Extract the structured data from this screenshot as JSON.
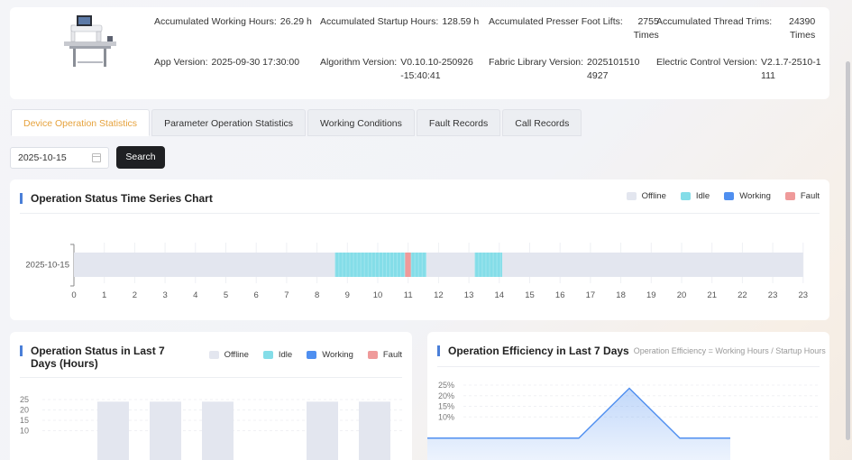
{
  "device_info": {
    "row1": [
      {
        "label": "Accumulated Working Hours:",
        "value": "26.29 h"
      },
      {
        "label": "Accumulated Startup Hours:",
        "value": "128.59 h"
      },
      {
        "label": "Accumulated Presser Foot Lifts:",
        "value": "2755 Times"
      },
      {
        "label": "Accumulated Thread Trims:",
        "value": "24390 Times"
      }
    ],
    "row2": [
      {
        "label": "App Version:",
        "value": "2025-09-30 17:30:00"
      },
      {
        "label": "Algorithm Version:",
        "value": "V0.10.10-250926-15:40:41"
      },
      {
        "label": "Fabric Library Version:",
        "value": "20251015104927"
      },
      {
        "label": "Electric Control Version:",
        "value": "V2.1.7-2510-1111"
      }
    ]
  },
  "tabs": [
    {
      "label": "Device Operation Statistics",
      "active": true
    },
    {
      "label": "Parameter Operation Statistics",
      "active": false
    },
    {
      "label": "Working Conditions",
      "active": false
    },
    {
      "label": "Fault Records",
      "active": false
    },
    {
      "label": "Call Records",
      "active": false
    }
  ],
  "search": {
    "date": "2025-10-15",
    "button_label": "Search"
  },
  "colors": {
    "offline": "#e3e6ef",
    "idle": "#84dde8",
    "working": "#4f8ff0",
    "fault": "#ef9a9a",
    "accent_tab": "#e6a23c",
    "title_bar": "#4a7fd8"
  },
  "legend_labels": {
    "offline": "Offline",
    "idle": "Idle",
    "working": "Working",
    "fault": "Fault"
  },
  "timeseries": {
    "title": "Operation Status Time Series Chart",
    "chart_data": {
      "type": "timeline",
      "row_label": "2025-10-15",
      "x_ticks": [
        "0",
        "1",
        "2",
        "3",
        "4",
        "5",
        "6",
        "7",
        "8",
        "9",
        "10",
        "11",
        "12",
        "13",
        "14",
        "15",
        "16",
        "17",
        "18",
        "19",
        "20",
        "21",
        "22",
        "23",
        "23"
      ],
      "xlim": [
        0,
        24
      ],
      "segments": [
        {
          "status": "offline",
          "start": 0,
          "end": 8.6
        },
        {
          "status": "idle",
          "start": 8.6,
          "end": 10.9
        },
        {
          "status": "fault",
          "start": 10.9,
          "end": 11.1
        },
        {
          "status": "idle",
          "start": 11.1,
          "end": 11.6
        },
        {
          "status": "offline",
          "start": 11.6,
          "end": 13.2
        },
        {
          "status": "idle",
          "start": 13.2,
          "end": 14.1
        },
        {
          "status": "offline",
          "start": 14.1,
          "end": 24
        }
      ]
    }
  },
  "last7": {
    "title": "Operation Status in Last 7 Days (Hours)",
    "chart_data": {
      "type": "bar",
      "y_ticks": [
        "25",
        "20",
        "15",
        "10"
      ],
      "ylim": [
        0,
        25
      ],
      "series": [
        {
          "name": "Offline",
          "values": [
            24,
            24,
            24,
            null,
            24,
            24
          ]
        }
      ]
    }
  },
  "efficiency": {
    "title": "Operation Efficiency in Last 7 Days",
    "subtitle": "Operation Efficiency = Working Hours / Startup Hours",
    "chart_data": {
      "type": "area",
      "y_ticks": [
        "25%",
        "20%",
        "15%",
        "10%"
      ],
      "ylim": [
        0,
        25
      ],
      "values": [
        0,
        0,
        0,
        0,
        23.5,
        0,
        0
      ]
    }
  }
}
